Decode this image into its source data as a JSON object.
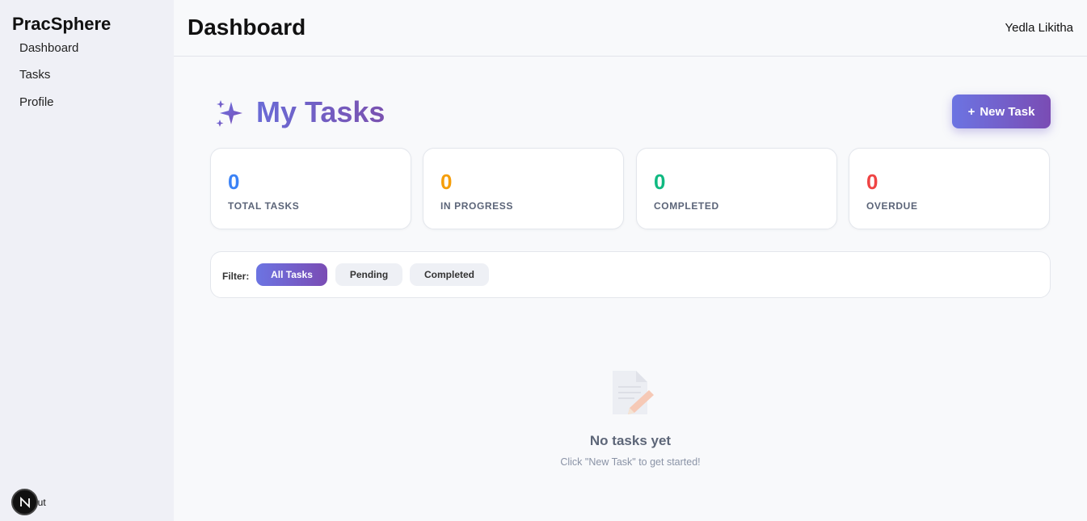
{
  "sidebar": {
    "brand": "PracSphere",
    "items": [
      {
        "label": "Dashboard"
      },
      {
        "label": "Tasks"
      },
      {
        "label": "Profile"
      }
    ],
    "logout_label": "out",
    "badge_letter": "N"
  },
  "header": {
    "title": "Dashboard",
    "user": "Yedla Likitha"
  },
  "main": {
    "heading": "My Tasks",
    "new_task_label": "New Task",
    "new_task_icon": "+",
    "stats": [
      {
        "value": "0",
        "label": "TOTAL TASKS",
        "color": "#3b82f6"
      },
      {
        "value": "0",
        "label": "IN PROGRESS",
        "color": "#f59e0b"
      },
      {
        "value": "0",
        "label": "COMPLETED",
        "color": "#10b981"
      },
      {
        "value": "0",
        "label": "OVERDUE",
        "color": "#ef4444"
      }
    ],
    "filter": {
      "label": "Filter:",
      "options": [
        {
          "label": "All Tasks",
          "active": true
        },
        {
          "label": "Pending",
          "active": false
        },
        {
          "label": "Completed",
          "active": false
        }
      ]
    },
    "empty": {
      "title": "No tasks yet",
      "subtitle": "Click \"New Task\" to get started!",
      "icon": "memo-icon"
    }
  },
  "colors": {
    "accent_start": "#6c74e2",
    "accent_end": "#7a4cb4"
  }
}
